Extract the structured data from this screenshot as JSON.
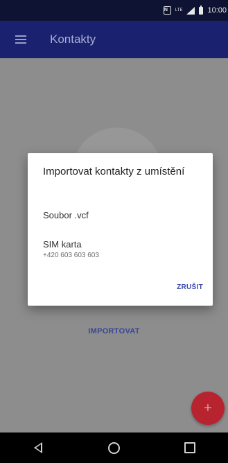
{
  "status_bar": {
    "lte_label": "LTE",
    "time": "10:00",
    "icons": [
      "nfc-icon",
      "lte-icon",
      "signal-icon",
      "battery-icon"
    ]
  },
  "app_bar": {
    "title": "Kontakty",
    "menu_icon": "hamburger-menu-icon",
    "background": "#1a2270"
  },
  "main": {
    "import_button_label": "IMPORTOVAT",
    "fab_icon": "plus-icon",
    "fab_label": "+",
    "fab_color": "#b7242f"
  },
  "dialog": {
    "title": "Importovat kontakty z umístění",
    "options": [
      {
        "label": "Soubor .vcf"
      },
      {
        "label": "SIM karta",
        "sub_label": "+420 603 603 603"
      }
    ],
    "cancel_label": "ZRUŠIT",
    "accent_color": "#3949ab"
  },
  "nav_bar": {
    "buttons": [
      "back-icon",
      "home-icon",
      "recents-icon"
    ]
  }
}
